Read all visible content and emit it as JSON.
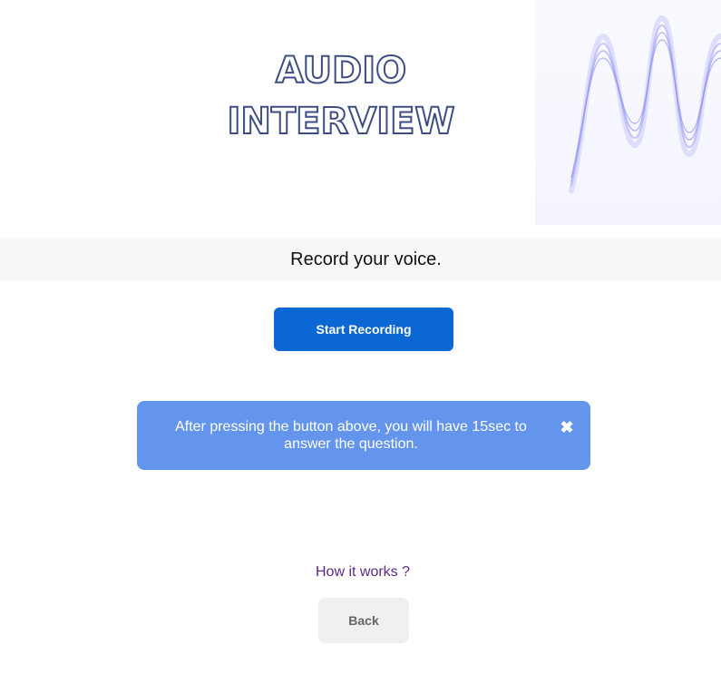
{
  "hero": {
    "title_line1": "AUDIO",
    "title_line2": "INTERVIEW",
    "wave_icon": "sound-wave-icon"
  },
  "prompt": {
    "text": "Record your voice."
  },
  "actions": {
    "start_label": "Start Recording",
    "back_label": "Back"
  },
  "alert": {
    "message": "After pressing the button above, you will have 15sec to answer the question.",
    "close_icon": "close-icon",
    "close_glyph": "✖"
  },
  "help": {
    "link_text": "How it works ?"
  },
  "colors": {
    "primary": "#0b67d4",
    "alert_bg": "#6495ed",
    "title_stroke": "#3d4d86",
    "link": "#5b2a86",
    "wave": "#6b6ef0"
  }
}
